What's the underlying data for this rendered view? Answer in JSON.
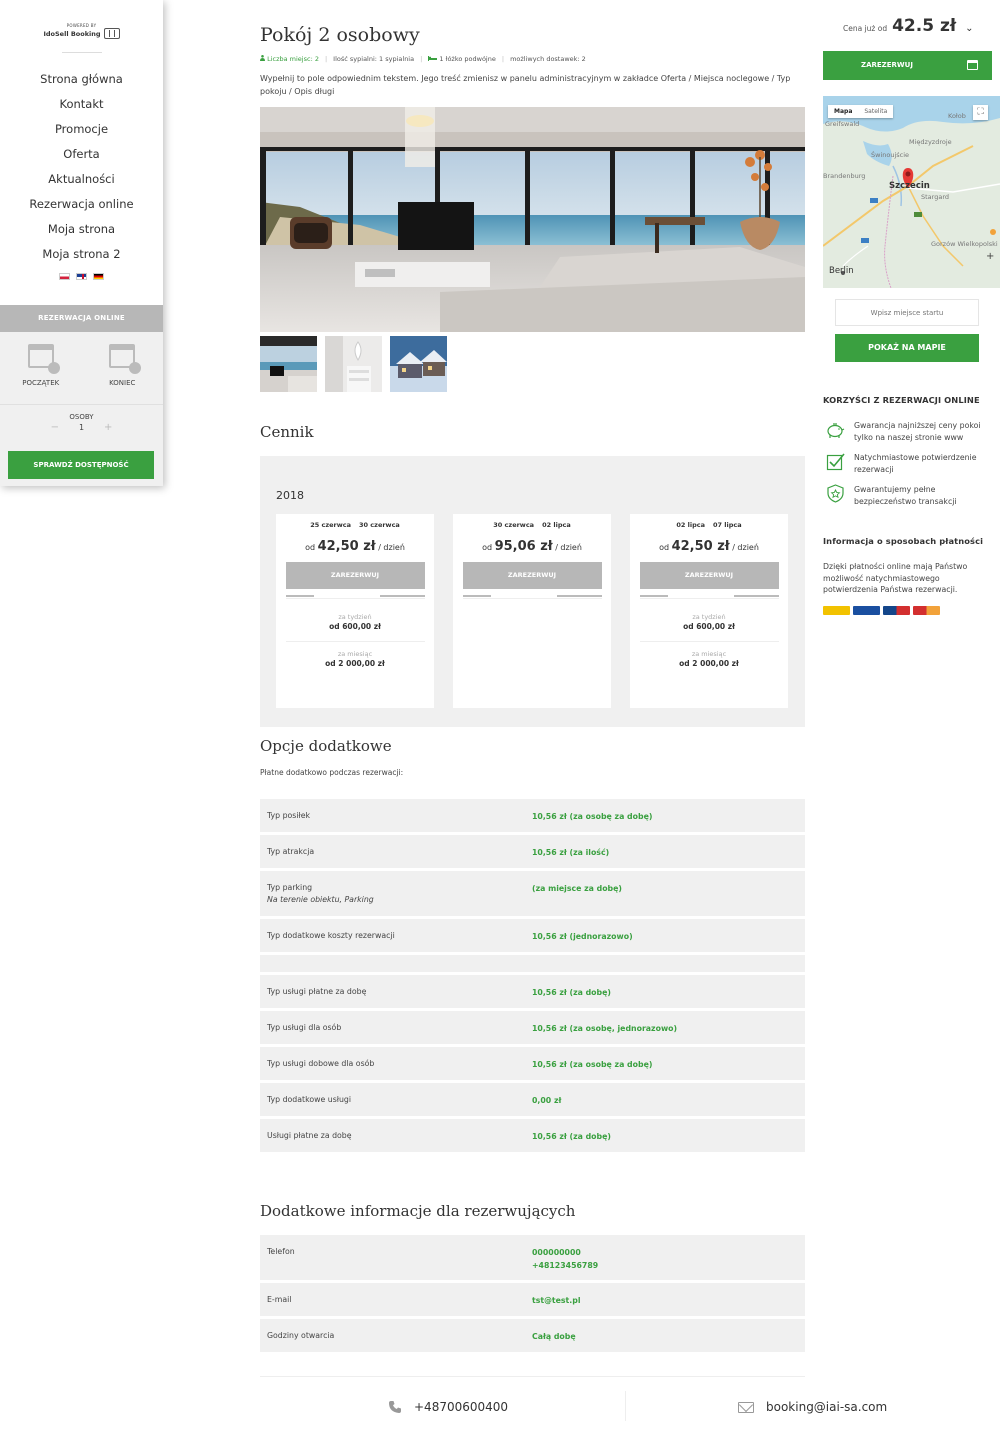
{
  "sidebar": {
    "logo": {
      "powered": "POWERED BY",
      "brand": "IdoSell Booking"
    },
    "nav": [
      "Strona główna",
      "Kontakt",
      "Promocje",
      "Oferta",
      "Aktualności",
      "Rezerwacja online",
      "Moja strona",
      "Moja strona 2"
    ],
    "booking": {
      "title": "REZERWACJA ONLINE",
      "start_label": "POCZĄTEK",
      "end_label": "KONIEC",
      "persons_label": "OSOBY",
      "persons_minus": "−",
      "persons_value": "1",
      "persons_plus": "+",
      "check_button": "SPRAWDŹ DOSTĘPNOŚĆ"
    }
  },
  "room": {
    "title": "Pokój 2 osobowy",
    "meta": {
      "places": "Liczba miejsc: 2",
      "bedrooms": "Ilość sypialni: 1 sypialnia",
      "beds": "1 łóżko podwójne",
      "extra_beds": "możliwych dostawek: 2"
    },
    "description": "Wypełnij to pole odpowiednim tekstem. Jego treść zmienisz w panelu administracyjnym w zakładce Oferta / Miejsca noclegowe / Typ pokoju / Opis długi"
  },
  "pricing": {
    "heading": "Cennik",
    "year": "2018",
    "cards": [
      {
        "from": "25 czerwca",
        "to": "30 czerwca",
        "price_prefix": "od",
        "price": "42,50 zł",
        "price_unit": "/ dzień",
        "button": "ZAREZERWUJ",
        "week_label": "za tydzień",
        "week_price": "od 600,00 zł",
        "month_label": "za miesiąc",
        "month_price": "od 2 000,00 zł"
      },
      {
        "from": "30 czerwca",
        "to": "02 lipca",
        "price_prefix": "od",
        "price": "95,06 zł",
        "price_unit": "/ dzień",
        "button": "ZAREZERWUJ"
      },
      {
        "from": "02 lipca",
        "to": "07 lipca",
        "price_prefix": "od",
        "price": "42,50 zł",
        "price_unit": "/ dzień",
        "button": "ZAREZERWUJ",
        "week_label": "za tydzień",
        "week_price": "od 600,00 zł",
        "month_label": "za miesiąc",
        "month_price": "od 2 000,00 zł"
      }
    ]
  },
  "options": {
    "heading": "Opcje dodatkowe",
    "subtitle": "Płatne dodatkowo podczas rezerwacji:",
    "rows": [
      {
        "name": "Typ posiłek",
        "note": "",
        "price": "10,56 zł (za osobę za dobę)"
      },
      {
        "name": "Typ atrakcja",
        "note": "",
        "price": "10,56 zł (za ilość)"
      },
      {
        "name": "Typ parking",
        "note": "Na terenie obiektu, Parking",
        "price": "(za miejsce za dobę)"
      },
      {
        "name": "Typ dodatkowe koszty rezerwacji",
        "note": "",
        "price": "10,56 zł (jednorazowo)"
      },
      {
        "name": "",
        "note": "",
        "price": ""
      },
      {
        "name": "Typ usługi płatne za dobę",
        "note": "",
        "price": "10,56 zł (za dobę)"
      },
      {
        "name": "Typ usługi dla osób",
        "note": "",
        "price": "10,56 zł (za osobę, jednorazowo)"
      },
      {
        "name": "Typ usługi dobowe dla osób",
        "note": "",
        "price": "10,56 zł (za osobę za dobę)"
      },
      {
        "name": "Typ dodatkowe usługi",
        "note": "",
        "price": "0,00 zł"
      },
      {
        "name": "Usługi płatne za dobę",
        "note": "",
        "price": "10,56 zł (za dobę)"
      }
    ]
  },
  "info": {
    "heading": "Dodatkowe informacje dla rezerwujących",
    "rows": [
      {
        "name": "Telefon",
        "value": "000000000",
        "value2": "+48123456789"
      },
      {
        "name": "E-mail",
        "value": "tst@test.pl",
        "value2": ""
      },
      {
        "name": "Godziny otwarcia",
        "value": "Całą dobę",
        "value2": ""
      }
    ]
  },
  "right": {
    "price_label": "Cena już od",
    "price_value": "42.5 zł",
    "book_button": "ZAREZERWUJ",
    "map": {
      "mode_map": "Mapa",
      "mode_satellite": "Satelita",
      "labels": [
        "Greifswald",
        "Międzyzdroje",
        "Świnoujście",
        "Brandenburg",
        "Szczecin",
        "Stargard",
        "Gorzów Wielkopolski",
        "Berlin",
        "Kołob"
      ]
    },
    "start_placeholder": "Wpisz miejsce startu",
    "show_map_button": "POKAŻ NA MAPIE",
    "benefits_heading": "KORZYŚCI Z REZERWACJI ONLINE",
    "benefits": [
      "Gwarancja najniższej ceny pokoi tylko na naszej stronie www",
      "Natychmiastowe potwierdzenie rezerwacji",
      "Gwarantujemy pełne bezpieczeństwo transakcji"
    ],
    "payment_heading": "Informacja o sposobach płatności",
    "payment_text": "Dzięki płatności online mają Państwo możliwość natychmiastowego potwierdzenia Państwa rezerwacji.",
    "card_colors": [
      "#f2c200",
      "#1a4fa0",
      "#14468a",
      "#d32f2f"
    ]
  },
  "footer": {
    "phone": "+48700600400",
    "email": "booking@iai-sa.com"
  }
}
